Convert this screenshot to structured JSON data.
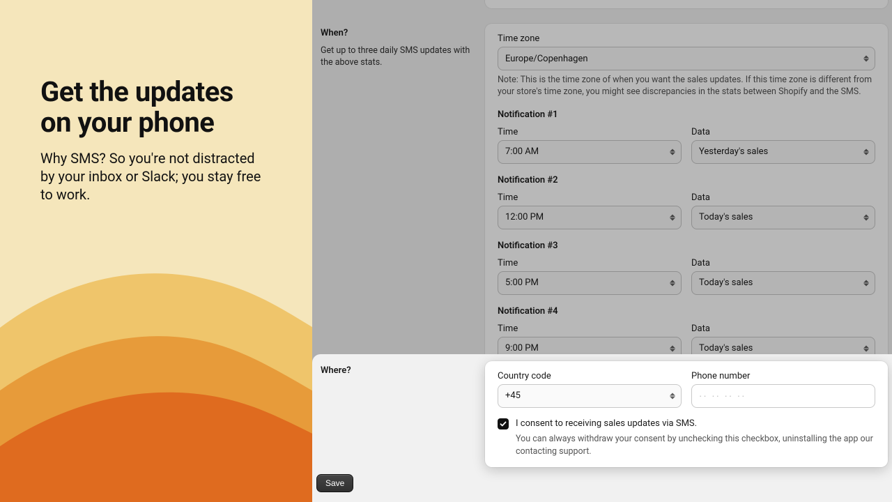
{
  "left": {
    "title_line1": "Get the updates",
    "title_line2": "on your phone",
    "subtitle": "Why SMS? So you're not distracted by your inbox or Slack; you stay free to work."
  },
  "when": {
    "heading": "When?",
    "description": "Get up to three daily SMS updates with the above stats.",
    "timezone_label": "Time zone",
    "timezone_value": "Europe/Copenhagen",
    "timezone_note": "Note: This is the time zone of when you want the sales updates. If this time zone is different from your store's time zone, you might see discrepancies in the stats between Shopify and the SMS.",
    "notifications": [
      {
        "title": "Notification #1",
        "time_label": "Time",
        "time_value": "7:00 AM",
        "data_label": "Data",
        "data_value": "Yesterday's sales"
      },
      {
        "title": "Notification #2",
        "time_label": "Time",
        "time_value": "12:00 PM",
        "data_label": "Data",
        "data_value": "Today's sales"
      },
      {
        "title": "Notification #3",
        "time_label": "Time",
        "time_value": "5:00 PM",
        "data_label": "Data",
        "data_value": "Today's sales"
      },
      {
        "title": "Notification #4",
        "time_label": "Time",
        "time_value": "9:00 PM",
        "data_label": "Data",
        "data_value": "Today's sales"
      }
    ]
  },
  "where": {
    "heading": "Where?",
    "country_code_label": "Country code",
    "country_code_value": "+45",
    "phone_label": "Phone number",
    "phone_placeholder": "·· ·· ·· ··",
    "consent_label": "I consent to receiving sales updates via SMS.",
    "consent_sub": "You can always withdraw your consent by unchecking this checkbox, uninstalling the app our contacting support.",
    "consent_checked": true
  },
  "actions": {
    "save_label": "Save"
  }
}
